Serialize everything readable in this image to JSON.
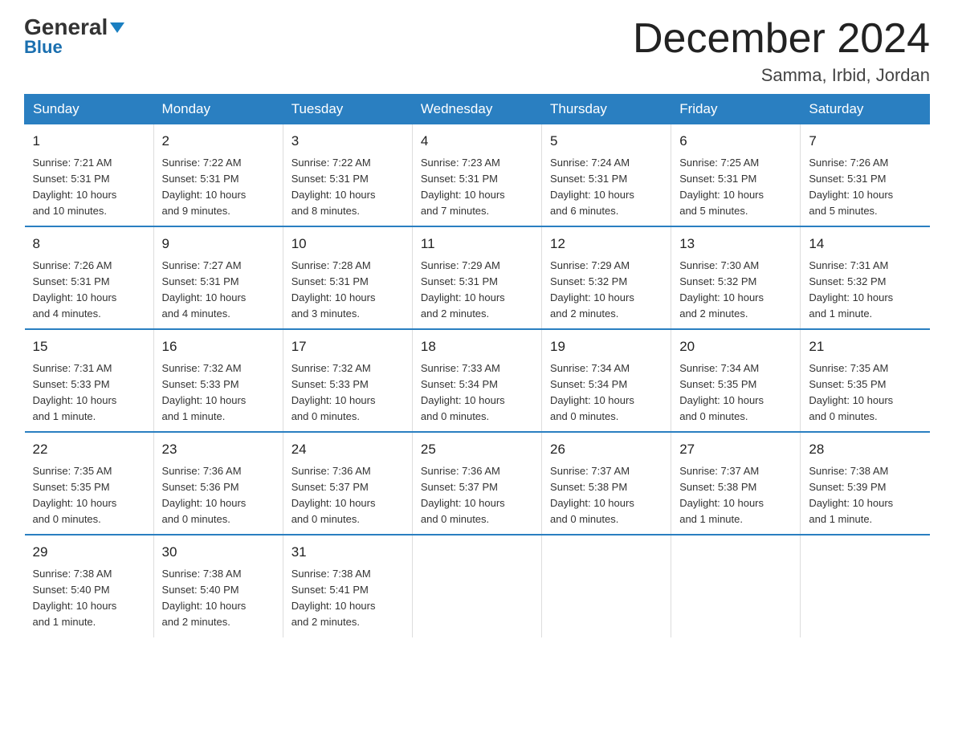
{
  "logo": {
    "brand": "General",
    "color_part": "Blue"
  },
  "title": "December 2024",
  "location": "Samma, Irbid, Jordan",
  "days_header": [
    "Sunday",
    "Monday",
    "Tuesday",
    "Wednesday",
    "Thursday",
    "Friday",
    "Saturday"
  ],
  "weeks": [
    [
      {
        "day": "1",
        "sunrise": "7:21 AM",
        "sunset": "5:31 PM",
        "daylight": "10 hours and 10 minutes."
      },
      {
        "day": "2",
        "sunrise": "7:22 AM",
        "sunset": "5:31 PM",
        "daylight": "10 hours and 9 minutes."
      },
      {
        "day": "3",
        "sunrise": "7:22 AM",
        "sunset": "5:31 PM",
        "daylight": "10 hours and 8 minutes."
      },
      {
        "day": "4",
        "sunrise": "7:23 AM",
        "sunset": "5:31 PM",
        "daylight": "10 hours and 7 minutes."
      },
      {
        "day": "5",
        "sunrise": "7:24 AM",
        "sunset": "5:31 PM",
        "daylight": "10 hours and 6 minutes."
      },
      {
        "day": "6",
        "sunrise": "7:25 AM",
        "sunset": "5:31 PM",
        "daylight": "10 hours and 5 minutes."
      },
      {
        "day": "7",
        "sunrise": "7:26 AM",
        "sunset": "5:31 PM",
        "daylight": "10 hours and 5 minutes."
      }
    ],
    [
      {
        "day": "8",
        "sunrise": "7:26 AM",
        "sunset": "5:31 PM",
        "daylight": "10 hours and 4 minutes."
      },
      {
        "day": "9",
        "sunrise": "7:27 AM",
        "sunset": "5:31 PM",
        "daylight": "10 hours and 4 minutes."
      },
      {
        "day": "10",
        "sunrise": "7:28 AM",
        "sunset": "5:31 PM",
        "daylight": "10 hours and 3 minutes."
      },
      {
        "day": "11",
        "sunrise": "7:29 AM",
        "sunset": "5:31 PM",
        "daylight": "10 hours and 2 minutes."
      },
      {
        "day": "12",
        "sunrise": "7:29 AM",
        "sunset": "5:32 PM",
        "daylight": "10 hours and 2 minutes."
      },
      {
        "day": "13",
        "sunrise": "7:30 AM",
        "sunset": "5:32 PM",
        "daylight": "10 hours and 2 minutes."
      },
      {
        "day": "14",
        "sunrise": "7:31 AM",
        "sunset": "5:32 PM",
        "daylight": "10 hours and 1 minute."
      }
    ],
    [
      {
        "day": "15",
        "sunrise": "7:31 AM",
        "sunset": "5:33 PM",
        "daylight": "10 hours and 1 minute."
      },
      {
        "day": "16",
        "sunrise": "7:32 AM",
        "sunset": "5:33 PM",
        "daylight": "10 hours and 1 minute."
      },
      {
        "day": "17",
        "sunrise": "7:32 AM",
        "sunset": "5:33 PM",
        "daylight": "10 hours and 0 minutes."
      },
      {
        "day": "18",
        "sunrise": "7:33 AM",
        "sunset": "5:34 PM",
        "daylight": "10 hours and 0 minutes."
      },
      {
        "day": "19",
        "sunrise": "7:34 AM",
        "sunset": "5:34 PM",
        "daylight": "10 hours and 0 minutes."
      },
      {
        "day": "20",
        "sunrise": "7:34 AM",
        "sunset": "5:35 PM",
        "daylight": "10 hours and 0 minutes."
      },
      {
        "day": "21",
        "sunrise": "7:35 AM",
        "sunset": "5:35 PM",
        "daylight": "10 hours and 0 minutes."
      }
    ],
    [
      {
        "day": "22",
        "sunrise": "7:35 AM",
        "sunset": "5:35 PM",
        "daylight": "10 hours and 0 minutes."
      },
      {
        "day": "23",
        "sunrise": "7:36 AM",
        "sunset": "5:36 PM",
        "daylight": "10 hours and 0 minutes."
      },
      {
        "day": "24",
        "sunrise": "7:36 AM",
        "sunset": "5:37 PM",
        "daylight": "10 hours and 0 minutes."
      },
      {
        "day": "25",
        "sunrise": "7:36 AM",
        "sunset": "5:37 PM",
        "daylight": "10 hours and 0 minutes."
      },
      {
        "day": "26",
        "sunrise": "7:37 AM",
        "sunset": "5:38 PM",
        "daylight": "10 hours and 0 minutes."
      },
      {
        "day": "27",
        "sunrise": "7:37 AM",
        "sunset": "5:38 PM",
        "daylight": "10 hours and 1 minute."
      },
      {
        "day": "28",
        "sunrise": "7:38 AM",
        "sunset": "5:39 PM",
        "daylight": "10 hours and 1 minute."
      }
    ],
    [
      {
        "day": "29",
        "sunrise": "7:38 AM",
        "sunset": "5:40 PM",
        "daylight": "10 hours and 1 minute."
      },
      {
        "day": "30",
        "sunrise": "7:38 AM",
        "sunset": "5:40 PM",
        "daylight": "10 hours and 2 minutes."
      },
      {
        "day": "31",
        "sunrise": "7:38 AM",
        "sunset": "5:41 PM",
        "daylight": "10 hours and 2 minutes."
      },
      null,
      null,
      null,
      null
    ]
  ],
  "labels": {
    "sunrise": "Sunrise:",
    "sunset": "Sunset:",
    "daylight": "Daylight:"
  }
}
